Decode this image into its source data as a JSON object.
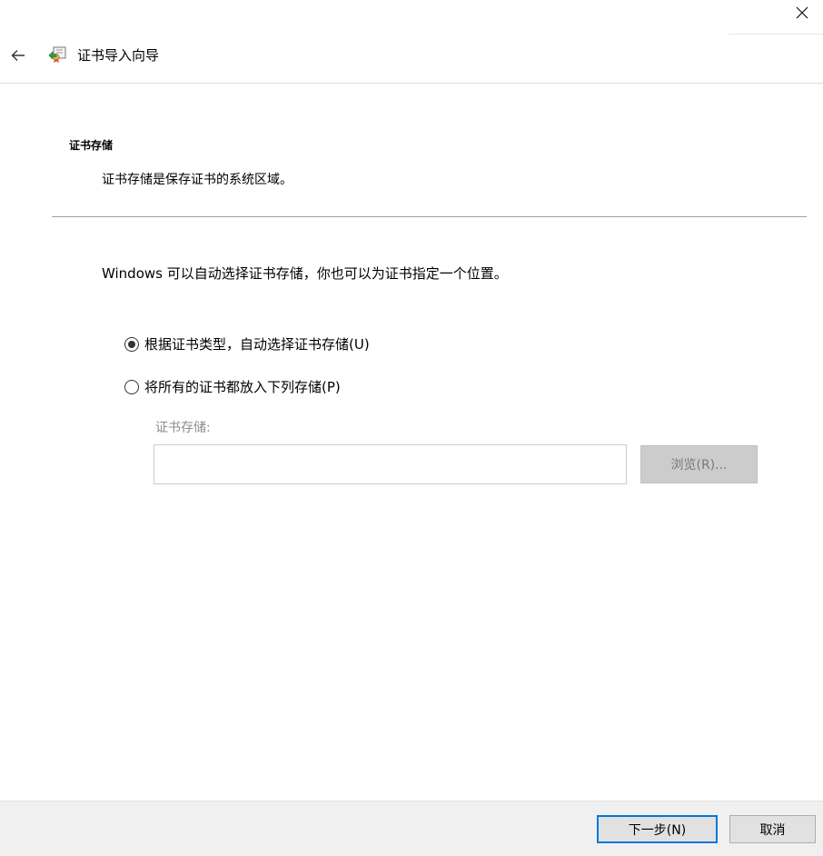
{
  "window": {
    "title": "证书导入向导",
    "close_icon": "close-icon",
    "back_icon": "back-arrow-icon",
    "app_icon": "certificate-icon"
  },
  "section": {
    "title": "证书存储",
    "description": "证书存储是保存证书的系统区域。"
  },
  "content": {
    "intro": "Windows 可以自动选择证书存储，你也可以为证书指定一个位置。",
    "options": [
      {
        "label": "根据证书类型，自动选择证书存储(U)",
        "selected": true
      },
      {
        "label": "将所有的证书都放入下列存储(P)",
        "selected": false
      }
    ],
    "store_label": "证书存储:",
    "store_value": "",
    "browse_label": "浏览(R)..."
  },
  "footer": {
    "next_label": "下一步(N)",
    "cancel_label": "取消"
  },
  "colors": {
    "accent": "#0078d7",
    "footer_bg": "#f0f0f0",
    "disabled_button_bg": "#cccccc",
    "disabled_text": "#8c8c8c"
  }
}
